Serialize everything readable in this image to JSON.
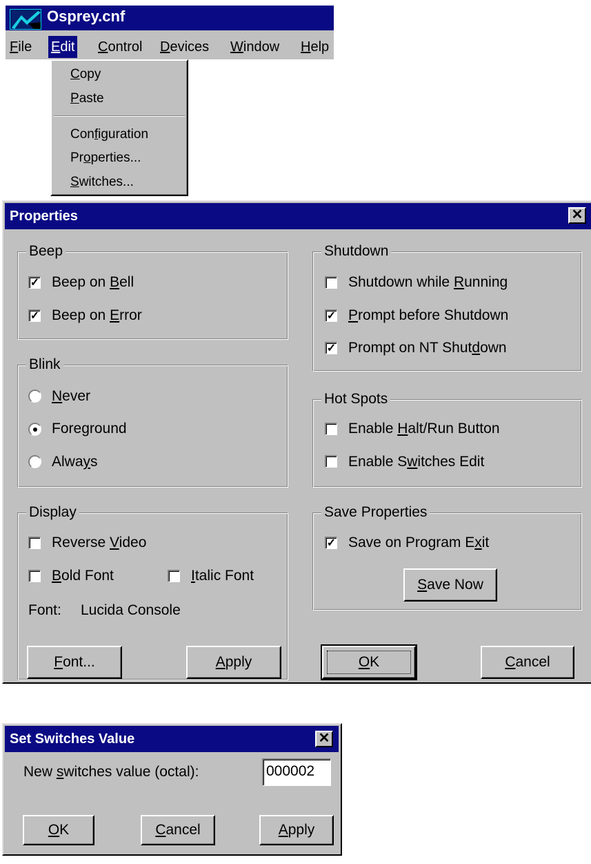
{
  "app": {
    "title": "Osprey.cnf",
    "menu": [
      {
        "pre": "",
        "u": "F",
        "post": "ile"
      },
      {
        "pre": "",
        "u": "E",
        "post": "dit"
      },
      {
        "pre": "",
        "u": "C",
        "post": "ontrol"
      },
      {
        "pre": "",
        "u": "D",
        "post": "evices"
      },
      {
        "pre": "",
        "u": "W",
        "post": "indow"
      },
      {
        "pre": "",
        "u": "H",
        "post": "elp"
      }
    ],
    "edit_menu": [
      {
        "pre": "",
        "u": "C",
        "post": "opy"
      },
      {
        "pre": "",
        "u": "P",
        "post": "aste"
      },
      {
        "pre": "Con",
        "u": "f",
        "post": "iguration"
      },
      {
        "pre": "Pr",
        "u": "o",
        "post": "perties..."
      },
      {
        "pre": "",
        "u": "S",
        "post": "witches..."
      }
    ]
  },
  "properties": {
    "title": "Properties",
    "close_glyph": "✕",
    "beep": {
      "legend": "Beep",
      "bell": {
        "pre": "Beep on ",
        "u": "B",
        "post": "ell",
        "checked": true
      },
      "error": {
        "pre": "Beep on ",
        "u": "E",
        "post": "rror",
        "checked": true
      }
    },
    "blink": {
      "legend": "Blink",
      "never": {
        "pre": "",
        "u": "N",
        "post": "ever",
        "selected": false
      },
      "foreground": {
        "pre": "Fore",
        "u": "g",
        "post": "round",
        "selected": true
      },
      "always": {
        "pre": "Alwa",
        "u": "y",
        "post": "s",
        "selected": false
      }
    },
    "display": {
      "legend": "Display",
      "reverse": {
        "pre": "Reverse ",
        "u": "V",
        "post": "ideo",
        "checked": false
      },
      "bold": {
        "pre": "",
        "u": "B",
        "post": "old Font",
        "checked": false
      },
      "italic": {
        "pre": "",
        "u": "I",
        "post": "talic Font",
        "checked": false
      },
      "font_label": "Font:",
      "font_name": "Lucida Console",
      "font_button": {
        "pre": "",
        "u": "F",
        "post": "ont..."
      },
      "apply_button": {
        "pre": "",
        "u": "A",
        "post": "pply"
      }
    },
    "shutdown": {
      "legend": "Shutdown",
      "while_running": {
        "pre": "Shutdown while ",
        "u": "R",
        "post": "unning",
        "checked": false
      },
      "prompt_before": {
        "pre": "",
        "u": "P",
        "post": "rompt before Shutdown",
        "checked": true
      },
      "prompt_nt": {
        "pre": "Prompt on NT Shut",
        "u": "d",
        "post": "own",
        "checked": true
      }
    },
    "hotspots": {
      "legend": "Hot Spots",
      "halt_run": {
        "pre": "Enable ",
        "u": "H",
        "post": "alt/Run Button",
        "checked": false
      },
      "switches_edit": {
        "pre": "Enable S",
        "u": "w",
        "post": "itches Edit",
        "checked": false
      }
    },
    "save": {
      "legend": "Save Properties",
      "on_exit": {
        "pre": "Save on Program E",
        "u": "x",
        "post": "it",
        "checked": true
      },
      "save_now": {
        "pre": "",
        "u": "S",
        "post": "ave Now"
      }
    },
    "ok": {
      "pre": "",
      "u": "O",
      "post": "K"
    },
    "cancel": {
      "pre": "",
      "u": "C",
      "post": "ancel"
    }
  },
  "switches": {
    "title": "Set Switches Value",
    "close_glyph": "✕",
    "label": {
      "pre": "New ",
      "u": "s",
      "post": "witches value (octal):"
    },
    "value": "000002",
    "ok": {
      "pre": "",
      "u": "O",
      "post": "K"
    },
    "cancel": {
      "pre": "",
      "u": "C",
      "post": "ancel"
    },
    "apply": {
      "pre": "",
      "u": "A",
      "post": "pply"
    }
  },
  "check_glyph": "✓"
}
